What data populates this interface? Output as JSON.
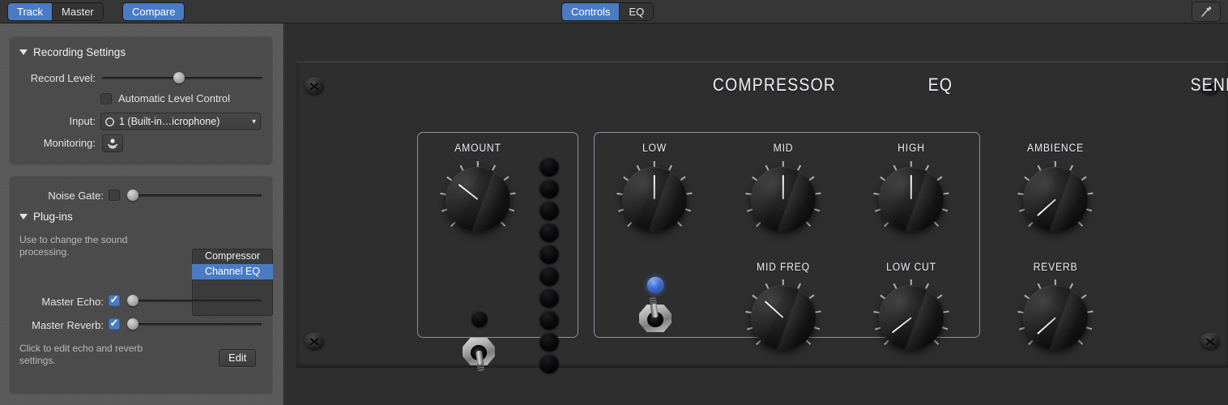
{
  "toolbar": {
    "track_master": [
      {
        "label": "Track",
        "active": true
      },
      {
        "label": "Master",
        "active": false
      }
    ],
    "compare_label": "Compare",
    "controls_eq": [
      {
        "label": "Controls",
        "active": true
      },
      {
        "label": "EQ",
        "active": false
      }
    ],
    "tuner_icon": "tuning-fork-icon"
  },
  "sidebar": {
    "recording": {
      "title": "Recording Settings",
      "disclosure_icon": "triangle-down-icon",
      "record_level_label": "Record Level:",
      "record_level_value": 48,
      "auto_level_label": "Automatic Level Control",
      "auto_level_checked": false,
      "input_label": "Input:",
      "input_value": "1 (Built-in…icrophone)",
      "input_mono_icon": "mono-circle-icon",
      "input_chevron_icon": "chevron-down-icon",
      "monitoring_label": "Monitoring:",
      "monitoring_icon": "monitor-speaker-icon"
    },
    "plugins": {
      "noise_gate_label": "Noise Gate:",
      "noise_gate_checked": false,
      "noise_gate_value": 0,
      "title": "Plug-ins",
      "disclosure_icon": "triangle-down-icon",
      "hint": "Use to change the sound processing.",
      "list": [
        {
          "label": "Compressor",
          "selected": false
        },
        {
          "label": "Channel EQ",
          "selected": true
        }
      ],
      "master_echo_label": "Master Echo:",
      "master_echo_checked": true,
      "master_echo_value": 0,
      "master_reverb_label": "Master Reverb:",
      "master_reverb_checked": true,
      "master_reverb_value": 0,
      "edit_hint": "Click to edit echo and reverb settings.",
      "edit_button": "Edit"
    }
  },
  "rack": {
    "sections": [
      {
        "title": "COMPRESSOR"
      },
      {
        "title": "EQ"
      },
      {
        "title": "SENDS"
      }
    ],
    "compressor": {
      "knob_label": "AMOUNT",
      "knob_angle": -52,
      "led_on": false,
      "switch_on": false,
      "meter_leds": 10,
      "meter_lit": 0
    },
    "eq": {
      "knobs": [
        {
          "label": "LOW",
          "angle": 0
        },
        {
          "label": "MID",
          "angle": 0
        },
        {
          "label": "HIGH",
          "angle": 0
        },
        {
          "label": "MID FREQ",
          "angle": -48
        },
        {
          "label": "LOW CUT",
          "angle": -128
        }
      ],
      "led_on": true,
      "switch_on": true
    },
    "sends": {
      "knobs": [
        {
          "label": "AMBIENCE",
          "angle": -132
        },
        {
          "label": "REVERB",
          "angle": -132
        }
      ]
    },
    "screws": [
      "screw-icon",
      "screw-icon",
      "screw-icon",
      "screw-icon"
    ]
  },
  "colors": {
    "accent_blue": "#4a7cc4",
    "panel_blue": "#44618f",
    "led_blue": "#3f6fd8",
    "sidebar_gray": "#5a5a5a"
  }
}
